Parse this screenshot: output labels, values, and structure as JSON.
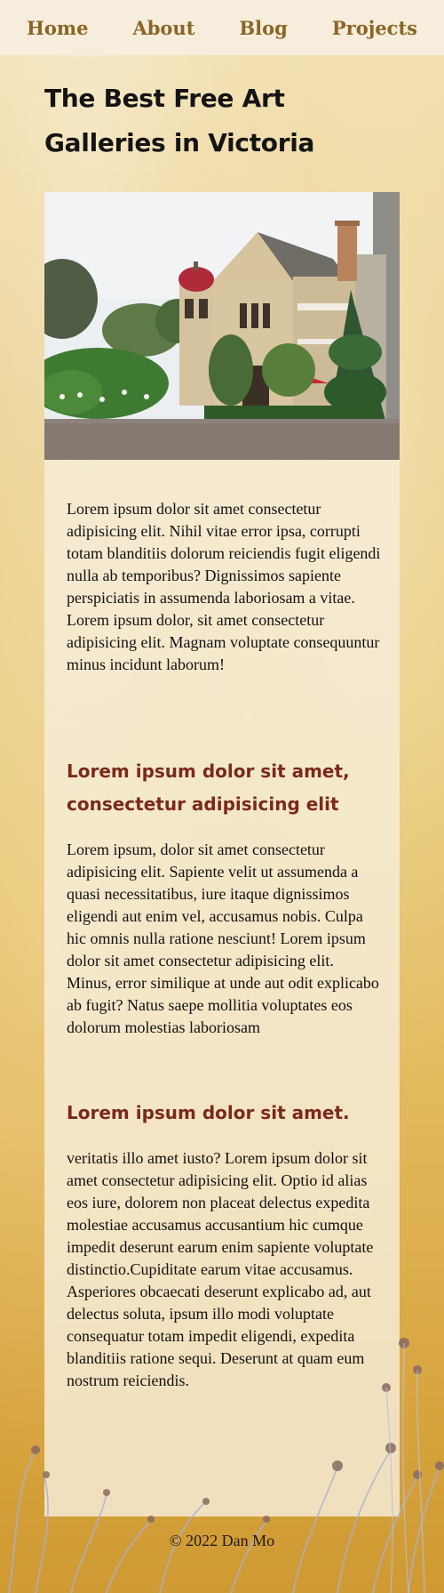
{
  "nav": {
    "items": [
      {
        "label": "Home"
      },
      {
        "label": "About"
      },
      {
        "label": "Blog"
      },
      {
        "label": "Projects"
      }
    ]
  },
  "page": {
    "title": "The Best Free Art Galleries in Victoria"
  },
  "article": {
    "paragraph_1": "Lorem ipsum dolor sit amet consectetur adipisicing elit. Nihil vitae error ipsa, corrupti totam blanditiis dolorum reiciendis fugit eligendi nulla ab temporibus? Dignissimos sapiente perspiciatis in assumenda laboriosam a vitae. Lorem ipsum dolor, sit amet consectetur adipisicing elit. Magnam voluptate consequuntur minus incidunt laborum!",
    "subheading_1": "Lorem ipsum dolor sit amet, consectetur adipisicing elit",
    "paragraph_2": "Lorem ipsum, dolor sit amet consectetur adipisicing elit. Sapiente velit ut assumenda a quasi necessitatibus, iure itaque dignissimos eligendi aut enim vel, accusamus nobis. Culpa hic omnis nulla ratione nesciunt! Lorem ipsum dolor sit amet consectetur adipisicing elit. Minus, error similique at unde aut odit explicabo ab fugit? Natus saepe mollitia voluptates eos dolorum molestias laboriosam",
    "subheading_2": "Lorem ipsum dolor sit amet.",
    "paragraph_3": "veritatis illo amet iusto? Lorem ipsum dolor sit amet consectetur adipisicing elit. Optio id alias eos iure, dolorem non placeat delectus expedita molestiae accusamus accusantium hic cumque impedit deserunt earum enim sapiente voluptate distinctio.Cupiditate earum vitae accusamus. Asperiores obcaecati deserunt explicabo ad, aut delectus soluta, ipsum illo modi voluptate consequatur totam impedit eligendi, expedita blanditiis ratione sequi. Deserunt at quam eum nostrum reiciendis."
  },
  "footer": {
    "text": "© 2022 Dan Mo"
  },
  "colors": {
    "nav_bg": "#f6eddd",
    "nav_link": "#8a6524",
    "subheading": "#7a2a1a",
    "panel_bg": "#f7eeda"
  }
}
